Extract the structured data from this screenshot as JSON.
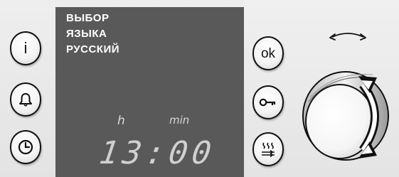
{
  "display": {
    "menu_lines": [
      "ВЫБОР",
      "ЯЗЫКА",
      "РУССКИЙ"
    ],
    "unit_hours": "h",
    "unit_minutes": "min",
    "time": "13:00"
  },
  "buttons": {
    "info": "i",
    "ok": "ok"
  },
  "icons": {
    "info": "info-icon",
    "alarm": "bell-icon",
    "clock": "clock-icon",
    "ok": "ok-icon",
    "lock": "key-icon",
    "program": "heat-program-icon",
    "knob_hint": "rotate-arrow-icon"
  },
  "colors": {
    "display_bg": "#595959",
    "display_text": "#ffffff",
    "panel_bg": "#e6e6e6"
  }
}
